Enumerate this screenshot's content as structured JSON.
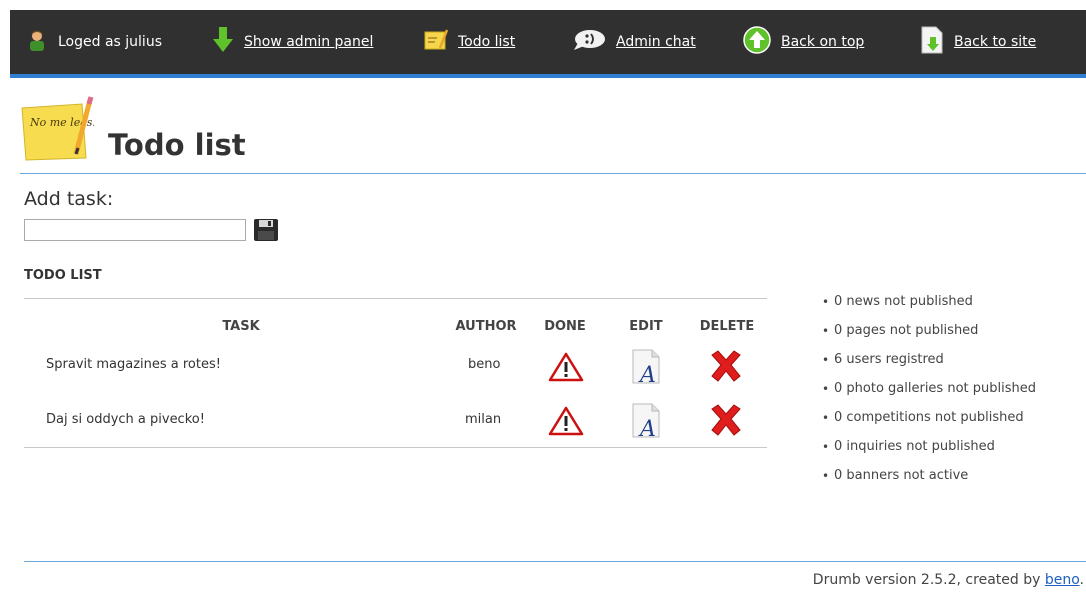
{
  "topbar": {
    "user_label": "Loged as julius",
    "admin_panel_link": "Show admin panel",
    "todo_link": "Todo list",
    "chat_link": "Admin chat",
    "top_link": "Back on top",
    "site_link": "Back to site"
  },
  "sticky_note_text": "No me leas!",
  "page_title": "Todo list",
  "add_task": {
    "label": "Add task:",
    "value": ""
  },
  "todo": {
    "heading": "TODO LIST",
    "columns": [
      "TASK",
      "AUTHOR",
      "DONE",
      "EDIT",
      "DELETE"
    ],
    "rows": [
      {
        "task": "Spravit magazines a rotes!",
        "author": "beno"
      },
      {
        "task": "Daj si oddych a pivecko!",
        "author": "milan"
      }
    ]
  },
  "stats": [
    "0 news not published",
    "0 pages not published",
    "6 users registred",
    "0 photo galleries not published",
    "0 competitions not published",
    "0 inquiries not published",
    "0 banners not active"
  ],
  "footer": {
    "text": "Drumb version 2.5.2, created by",
    "author_link": "beno",
    "suffix": "."
  },
  "colors": {
    "topbar_bg": "#303030",
    "accent_blue": "#2f7fd3",
    "arrow_green": "#5fc22a",
    "delete_red": "#e01d1d",
    "warning_red": "#cc1010"
  }
}
